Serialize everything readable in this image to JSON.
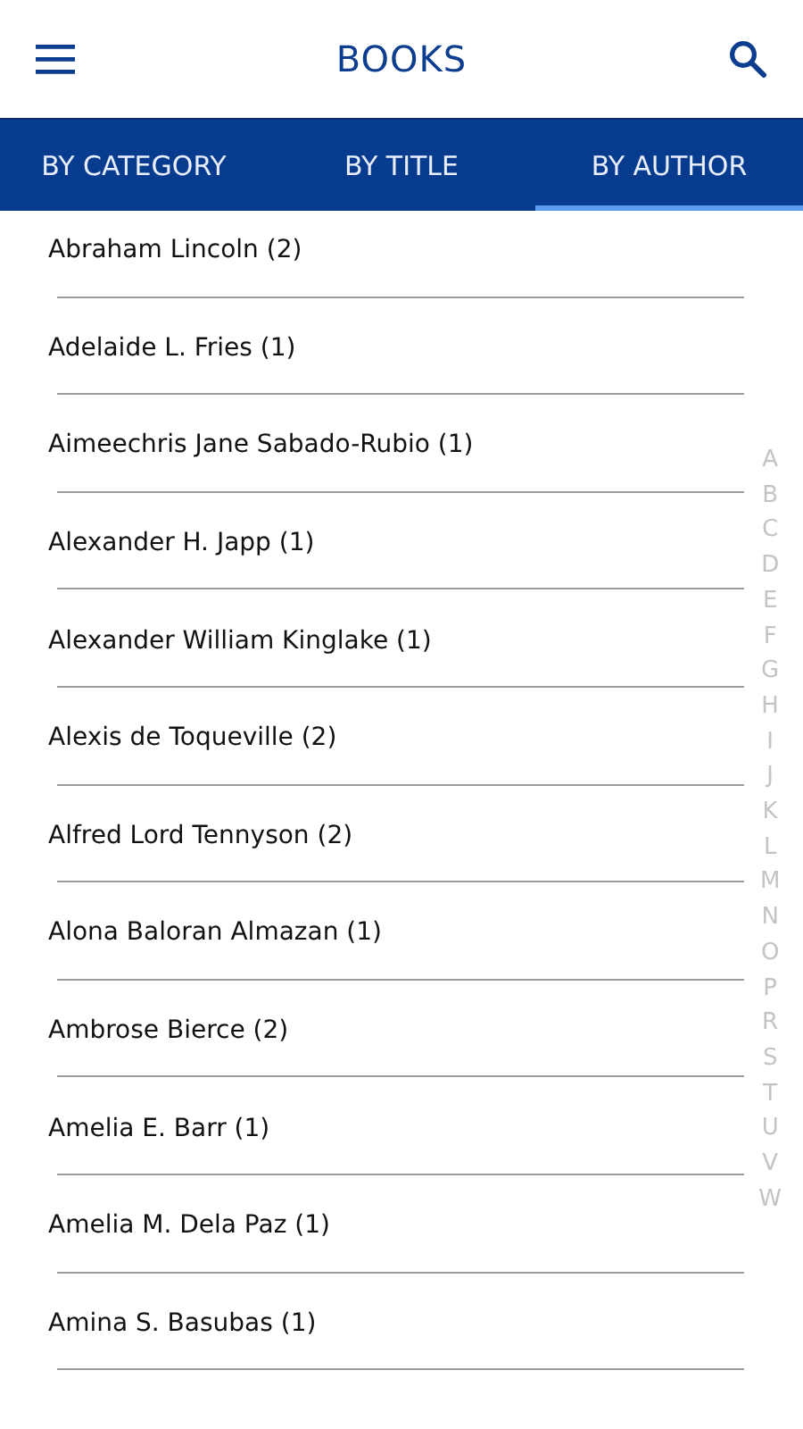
{
  "app_bar": {
    "title": "BOOKS"
  },
  "tabs": [
    {
      "label": "BY CATEGORY",
      "selected": false
    },
    {
      "label": "BY TITLE",
      "selected": false
    },
    {
      "label": "BY AUTHOR",
      "selected": true
    }
  ],
  "authors": [
    "Abraham Lincoln (2)",
    "Adelaide L. Fries (1)",
    "Aimeechris Jane Sabado-Rubio (1)",
    "Alexander H. Japp (1)",
    "Alexander William Kinglake (1)",
    "Alexis de Toqueville (2)",
    "Alfred Lord Tennyson (2)",
    "Alona Baloran Almazan (1)",
    "Ambrose Bierce (2)",
    "Amelia E. Barr (1)",
    "Amelia M. Dela Paz (1)",
    "Amina S. Basubas (1)"
  ],
  "alphabet_index": [
    "A",
    "B",
    "C",
    "D",
    "E",
    "F",
    "G",
    "H",
    "I",
    "J",
    "K",
    "L",
    "M",
    "N",
    "O",
    "P",
    "R",
    "S",
    "T",
    "U",
    "V",
    "W"
  ]
}
